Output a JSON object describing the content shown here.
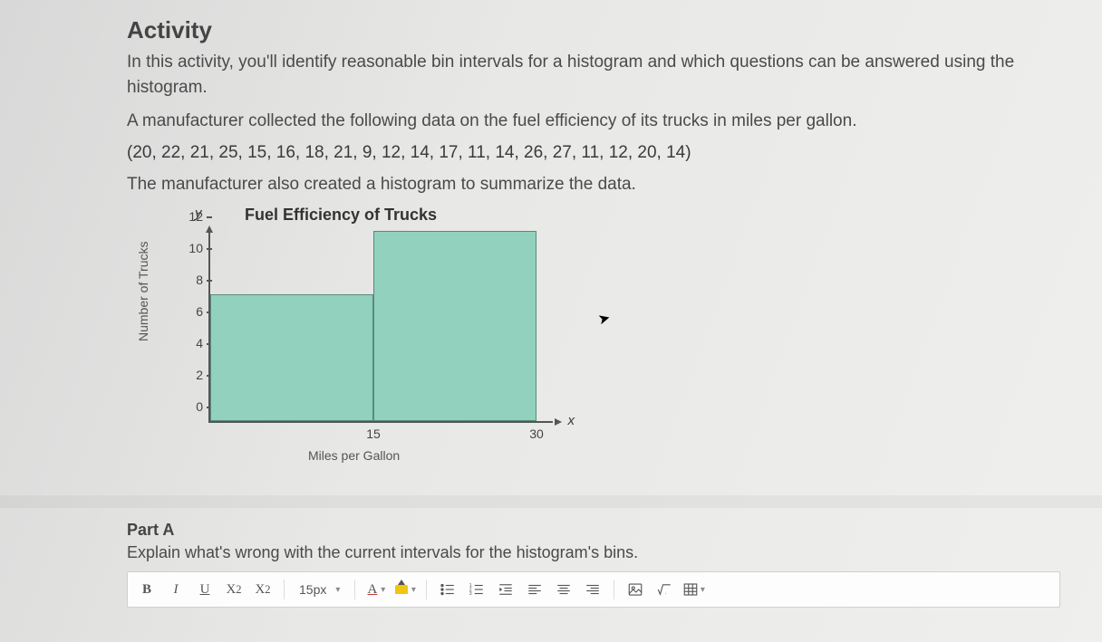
{
  "heading": "Activity",
  "intro": "In this activity, you'll identify reasonable bin intervals for a histogram and which questions can be answered using the histogram.",
  "context": "A manufacturer collected the following data on the fuel efficiency of its trucks in miles per gallon.",
  "data_values_text": "(20, 22, 21, 25, 15, 16, 18, 21, 9, 12, 14, 17, 11, 14, 26, 27, 11, 12, 20, 14)",
  "followup": "The manufacturer also created a histogram to summarize the data.",
  "chart_data": {
    "type": "bar",
    "title": "Fuel Efficiency of Trucks",
    "xlabel": "Miles per Gallon",
    "ylabel": "Number of Trucks",
    "y_var": "y",
    "x_var": "x",
    "y_ticks": [
      0,
      2,
      4,
      6,
      8,
      10,
      12
    ],
    "x_ticks": [
      15,
      30
    ],
    "ylim": [
      0,
      12
    ],
    "xlim": [
      0,
      30
    ],
    "bins": [
      {
        "range": [
          0,
          15
        ],
        "count": 8
      },
      {
        "range": [
          15,
          30
        ],
        "count": 12
      }
    ]
  },
  "part": {
    "label": "Part A",
    "prompt": "Explain what's wrong with the current intervals for the histogram's bins."
  },
  "toolbar": {
    "bold": "B",
    "italic": "I",
    "underline": "U",
    "sup": "X",
    "sub": "X",
    "fontsize": "15px",
    "color_letter": "A"
  }
}
